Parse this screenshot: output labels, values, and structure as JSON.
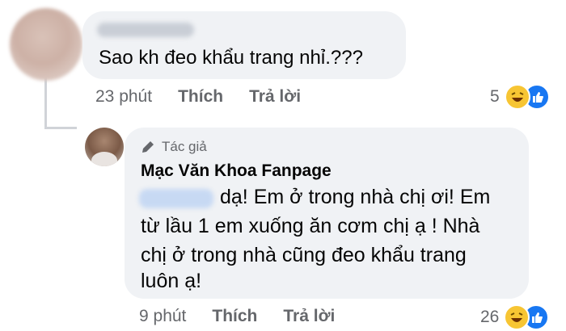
{
  "comments": [
    {
      "text": "Sao kh đeo khẩu trang nhỉ.???",
      "time": "23 phút",
      "like": "Thích",
      "reply": "Trả lời",
      "reaction_count": "5"
    },
    {
      "author_badge": "Tác giả",
      "author": "Mạc Văn Khoa Fanpage",
      "line1": "dạ! Em ở trong nhà chị ơi! Em",
      "line2": "từ lầu 1 em xuống ăn cơm chị ạ ! Nhà",
      "line3": "chị ở trong nhà cũng đeo khẩu trang",
      "line4": "luôn ạ!",
      "time": "9 phút",
      "like": "Thích",
      "reply": "Trả lời",
      "reaction_count": "26"
    }
  ],
  "colors": {
    "bubble": "#f0f2f5",
    "meta": "#65676b",
    "like": "#1877f2",
    "haha": "#f7c533"
  },
  "icons": [
    "pencil-icon",
    "haha-reaction-icon",
    "like-reaction-icon"
  ]
}
